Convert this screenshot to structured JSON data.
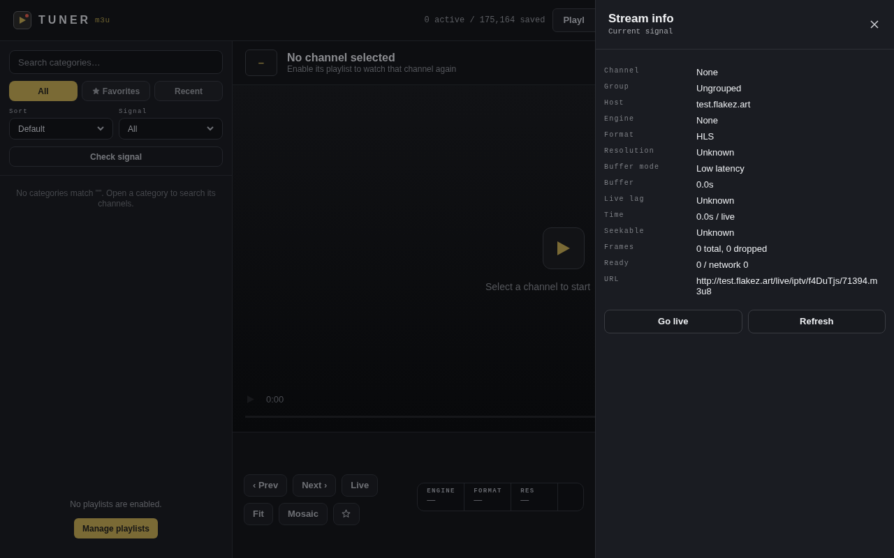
{
  "header": {
    "brand": "TUNER",
    "tag": "m3u",
    "counts": "0 active / 175,164 saved",
    "playlists_button": "Playl"
  },
  "sidebar": {
    "search": {
      "placeholder": "Search categories…"
    },
    "filters": [
      {
        "label": "All",
        "selected": true,
        "kind": "text"
      },
      {
        "label": "Favorites",
        "selected": false,
        "kind": "star"
      },
      {
        "label": "Recent",
        "selected": false,
        "kind": "text"
      }
    ],
    "selects": [
      {
        "label": "Sort",
        "value": "Default"
      },
      {
        "label": "Signal",
        "value": "All"
      }
    ],
    "check_button": "Check signal",
    "empty_message": "No categories match \"\". Open a category to search its channels.",
    "playlists_message": "No playlists are enabled.",
    "manage_button": "Manage playlists"
  },
  "main": {
    "channel_badge": "–",
    "title": "No channel selected",
    "subtitle": "Enable its playlist to watch that channel again",
    "player": {
      "prompt": "Select a channel to start",
      "time": "0:00"
    },
    "controls": [
      {
        "kind": "text",
        "label": "‹ Prev"
      },
      {
        "kind": "text",
        "label": "Next ›"
      },
      {
        "kind": "text",
        "label": "Live"
      },
      {
        "kind": "text",
        "label": "Fit"
      },
      {
        "kind": "text",
        "label": "Mosaic"
      },
      {
        "kind": "star"
      }
    ],
    "stats": [
      {
        "label": "ENGINE",
        "value": "—"
      },
      {
        "label": "FORMAT",
        "value": "—"
      },
      {
        "label": "RES",
        "value": "—"
      }
    ]
  },
  "drawer": {
    "title": "Stream info",
    "subtitle": "Current signal",
    "rows": [
      {
        "label": "Channel",
        "value": "None"
      },
      {
        "label": "Group",
        "value": "Ungrouped"
      },
      {
        "label": "Host",
        "value": "test.flakez.art"
      },
      {
        "label": "Engine",
        "value": "None"
      },
      {
        "label": "Format",
        "value": "HLS"
      },
      {
        "label": "Resolution",
        "value": "Unknown"
      },
      {
        "label": "Buffer mode",
        "value": "Low latency"
      },
      {
        "label": "Buffer",
        "value": "0.0s"
      },
      {
        "label": "Live lag",
        "value": "Unknown"
      },
      {
        "label": "Time",
        "value": "0.0s / live"
      },
      {
        "label": "Seekable",
        "value": "Unknown"
      },
      {
        "label": "Frames",
        "value": "0 total, 0 dropped"
      },
      {
        "label": "Ready",
        "value": "0 / network 0"
      },
      {
        "label": "URL",
        "value": "http://test.flakez.art/live/iptv/f4DuTjs/71394.m3u8"
      }
    ],
    "buttons": [
      "Go live",
      "Refresh"
    ]
  }
}
